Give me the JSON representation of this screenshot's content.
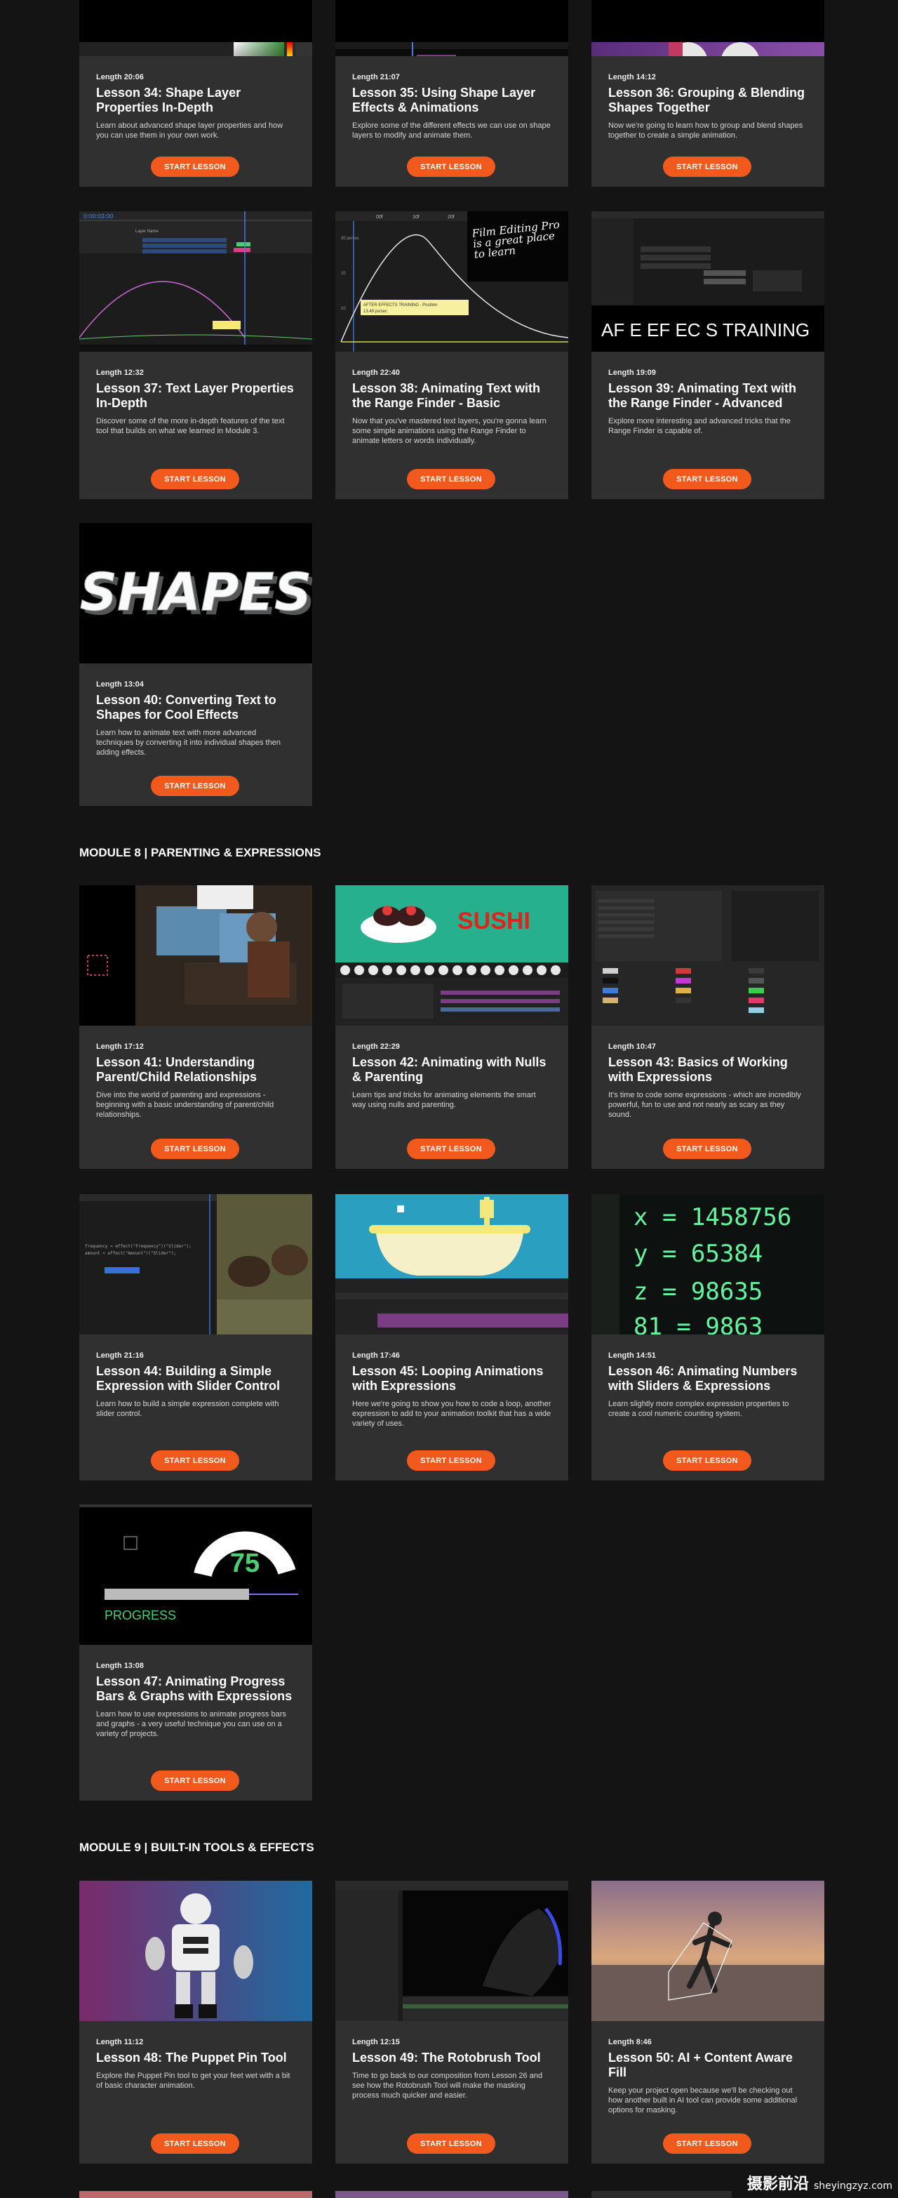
{
  "modules": [
    {
      "title": "MODULE 8 | PARENTING & EXPRESSIONS"
    },
    {
      "title": "MODULE 9 | BUILT-IN TOOLS & EFFECTS"
    }
  ],
  "cta_label": "START LESSON",
  "lessons": [
    {
      "length": "Length 20:06",
      "title": "Lesson 34: Shape Layer Properties In-Depth",
      "desc": "Learn about advanced shape layer properties and how you can use them in your own work."
    },
    {
      "length": "Length 21:07",
      "title": "Lesson 35: Using Shape Layer Effects & Animations",
      "desc": "Explore some of the different effects we can use on shape layers to modify and animate them."
    },
    {
      "length": "Length 14:12",
      "title": "Lesson 36: Grouping & Blending Shapes Together",
      "desc": "Now we're going to learn how to group and blend shapes together to create a simple animation."
    },
    {
      "length": "Length 12:32",
      "title": "Lesson 37: Text Layer Properties In-Depth",
      "desc": "Discover some of the more in-depth features of the text tool that builds on what we learned in Module 3."
    },
    {
      "length": "Length 22:40",
      "title": "Lesson 38: Animating Text with the Range Finder - Basic",
      "desc": "Now that you've mastered text layers, you're gonna learn some simple animations using the Range Finder to animate letters or words individually."
    },
    {
      "length": "Length 19:09",
      "title": "Lesson 39: Animating Text with the Range Finder - Advanced",
      "desc": "Explore more interesting and advanced tricks that the Range Finder is capable of."
    },
    {
      "length": "Length 13:04",
      "title": "Lesson 40: Converting Text to Shapes for Cool Effects",
      "desc": "Learn how to animate text with more advanced techniques by converting it into individual shapes then adding effects."
    },
    {
      "length": "Length 17:12",
      "title": "Lesson 41: Understanding Parent/Child Relationships",
      "desc": "Dive into the world of parenting and expressions - beginning with a basic understanding of parent/child relationships."
    },
    {
      "length": "Length 22:29",
      "title": "Lesson 42: Animating with Nulls & Parenting",
      "desc": "Learn tips and tricks for animating elements the smart way using nulls and parenting."
    },
    {
      "length": "Length 10:47",
      "title": "Lesson 43: Basics of Working with Expressions",
      "desc": "It's time to code some expressions - which are incredibly powerful, fun to use and not nearly as scary as they sound."
    },
    {
      "length": "Length 21:16",
      "title": "Lesson 44: Building a Simple Expression with Slider Control",
      "desc": "Learn how to build a simple expression complete with slider control."
    },
    {
      "length": "Length 17:46",
      "title": "Lesson 45: Looping Animations with Expressions",
      "desc": "Here we're going to show you how to code a loop, another expression to add to your animation toolkit that has a wide variety of uses."
    },
    {
      "length": "Length 14:51",
      "title": "Lesson 46: Animating Numbers with Sliders & Expressions",
      "desc": "Learn slightly more complex expression properties to create a cool numeric counting system."
    },
    {
      "length": "Length 13:08",
      "title": "Lesson 47: Animating Progress Bars & Graphs with Expressions",
      "desc": "Learn how to use expressions to animate progress bars and graphs - a very useful technique you can use on a variety of projects."
    },
    {
      "length": "Length 11:12",
      "title": "Lesson 48: The Puppet Pin Tool",
      "desc": "Explore the Puppet Pin tool to get your feet wet with a bit of basic character animation."
    },
    {
      "length": "Length 12:15",
      "title": "Lesson 49: The Rotobrush Tool",
      "desc": "Time to go back to our composition from Lesson 26 and see how the Rotobrush Tool will make the masking process much quicker and easier."
    },
    {
      "length": "Length 8:46",
      "title": "Lesson 50: AI + Content Aware Fill",
      "desc": "Keep your project open because we'll be checking out how another built in AI tool can provide some additional options for masking."
    }
  ],
  "thumbs": {
    "lesson37_timecode": "0:00:03:00",
    "lesson37_panel": "Layer Name",
    "lesson38_overlay": "Film Editing Pro is a great place to learn",
    "lesson38_tooltip": "AFTER EFFECTS TRAINING - Position",
    "lesson38_tooltip2": "13.49 px/sec",
    "lesson38_ruler": [
      "00f",
      "10f",
      "20f",
      "01:00f"
    ],
    "lesson38_yaxis": [
      "30 px/sec",
      "20",
      "10"
    ],
    "lesson39_text": "AF E EF EC S TRAINING",
    "lesson40_text": "SHAPES",
    "lesson42_text": "SUSHI",
    "lesson46_lines": [
      "x = 1458756",
      "y = 65384",
      "z = 98635",
      "81 = 9863"
    ],
    "lesson47_value": "75",
    "lesson47_label": "PROGRESS",
    "lesson44_code": [
      "frequency = effect(\"Frequency\")(\"Slider\");",
      "amount = effect(\"Amount\")(\"Slider\");"
    ]
  },
  "watermark": {
    "cn": "摄影前沿",
    "url": "sheyingzyz.com"
  },
  "colors": {
    "accent": "#f25a1d",
    "card": "#303030",
    "background": "#141414"
  }
}
